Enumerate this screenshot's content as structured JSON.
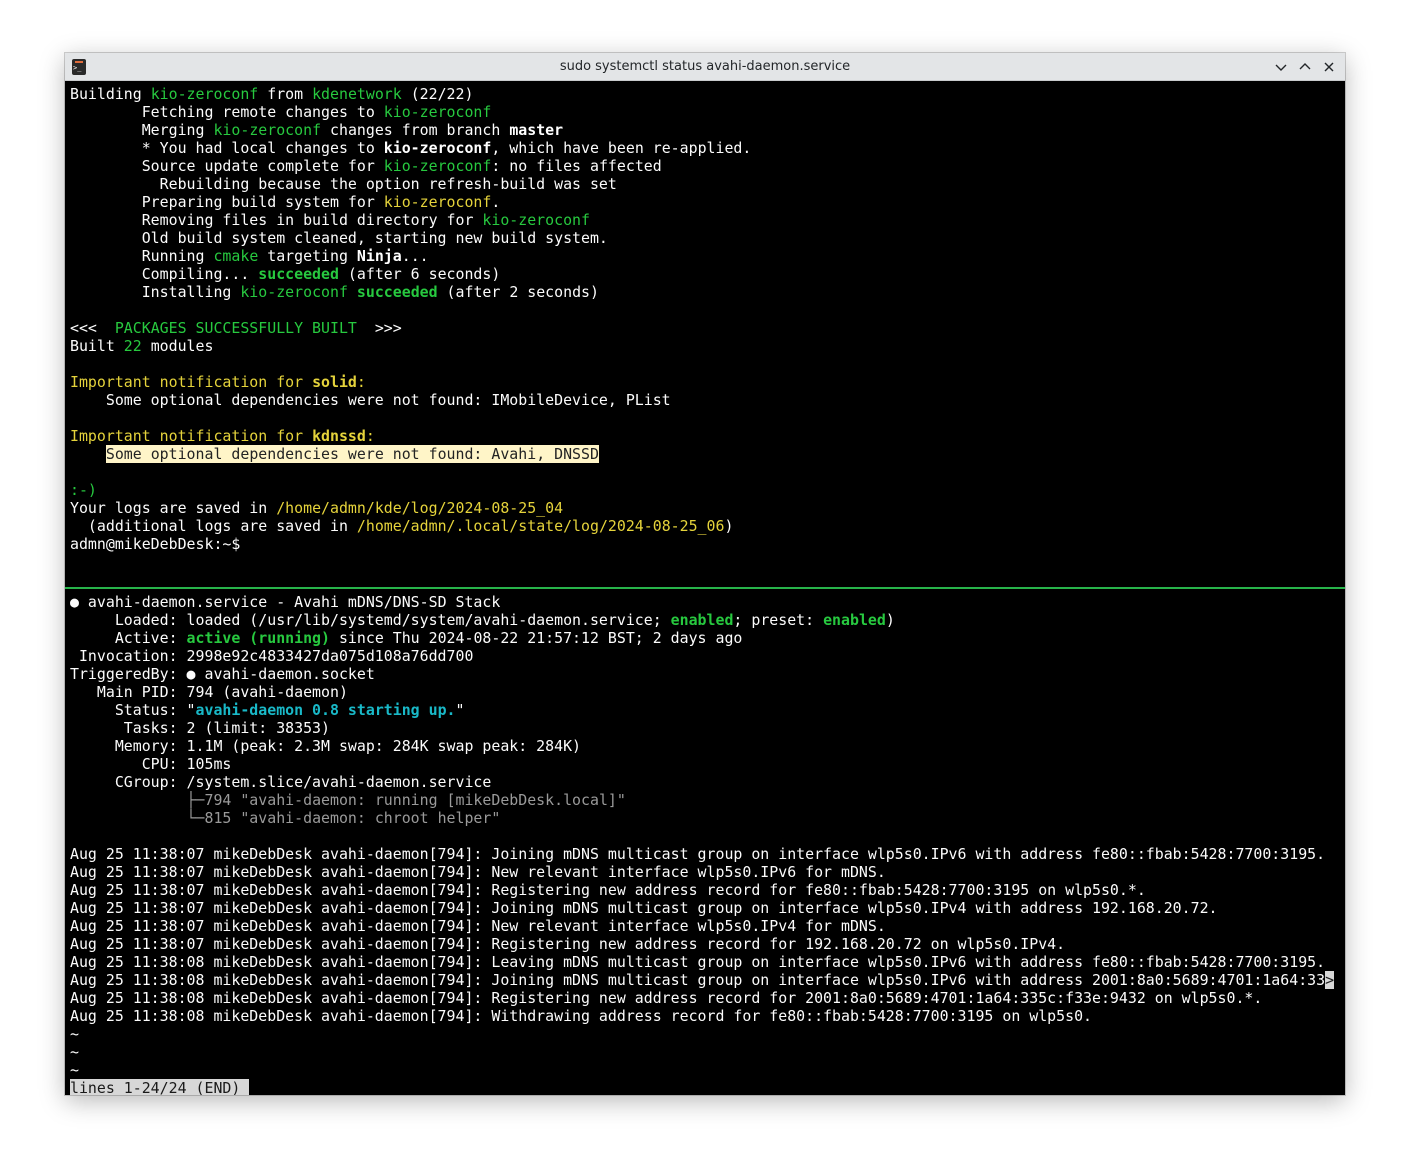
{
  "window": {
    "title": "sudo systemctl status avahi-daemon.service"
  },
  "top_pane": {
    "lines": [
      [
        {
          "t": "Building "
        },
        {
          "t": "kio-zeroconf",
          "s": "g"
        },
        {
          "t": " from "
        },
        {
          "t": "kdenetwork",
          "s": "g"
        },
        {
          "t": " (22/22)"
        }
      ],
      [
        {
          "t": "        Fetching remote changes to "
        },
        {
          "t": "kio-zeroconf",
          "s": "g"
        }
      ],
      [
        {
          "t": "        Merging "
        },
        {
          "t": "kio-zeroconf",
          "s": "g"
        },
        {
          "t": " changes from branch "
        },
        {
          "t": "master",
          "s": "b"
        }
      ],
      [
        {
          "t": "        * You had local changes to "
        },
        {
          "t": "kio-zeroconf",
          "s": "b"
        },
        {
          "t": ", which have been re-applied."
        }
      ],
      [
        {
          "t": "        Source update complete for "
        },
        {
          "t": "kio-zeroconf",
          "s": "g"
        },
        {
          "t": ": no files affected"
        }
      ],
      [
        {
          "t": "          Rebuilding because the option refresh-build was set"
        }
      ],
      [
        {
          "t": "        Preparing build system for "
        },
        {
          "t": "kio-zeroconf",
          "s": "y"
        },
        {
          "t": "."
        }
      ],
      [
        {
          "t": "        Removing files in build directory for "
        },
        {
          "t": "kio-zeroconf",
          "s": "g"
        }
      ],
      [
        {
          "t": "        Old build system cleaned, starting new build system."
        }
      ],
      [
        {
          "t": "        Running "
        },
        {
          "t": "cmake",
          "s": "g"
        },
        {
          "t": " targeting "
        },
        {
          "t": "Ninja",
          "s": "b"
        },
        {
          "t": "..."
        }
      ],
      [
        {
          "t": "        Compiling... "
        },
        {
          "t": "succeeded",
          "s": "gb"
        },
        {
          "t": " (after 6 seconds)"
        }
      ],
      [
        {
          "t": "        Installing "
        },
        {
          "t": "kio-zeroconf",
          "s": "g"
        },
        {
          "t": " "
        },
        {
          "t": "succeeded",
          "s": "gb"
        },
        {
          "t": " (after 2 seconds)"
        }
      ],
      [],
      [
        {
          "t": "<<<  "
        },
        {
          "t": "PACKAGES SUCCESSFULLY BUILT",
          "s": "g"
        },
        {
          "t": "  >>>"
        }
      ],
      [
        {
          "t": "Built "
        },
        {
          "t": "22",
          "s": "g"
        },
        {
          "t": " modules"
        }
      ],
      [],
      [
        {
          "t": "Important notification for ",
          "s": "y"
        },
        {
          "t": "solid",
          "s": "yb"
        },
        {
          "t": ":",
          "s": "y"
        }
      ],
      [
        {
          "t": "    Some optional dependencies were not found: IMobileDevice, PList"
        }
      ],
      [],
      [
        {
          "t": "Important notification for ",
          "s": "y"
        },
        {
          "t": "kdnssd",
          "s": "yb"
        },
        {
          "t": ":",
          "s": "y"
        }
      ],
      [
        {
          "t": "    "
        },
        {
          "t": "Some optional dependencies were not found: Avahi, DNSSD",
          "s": "hl"
        }
      ],
      [],
      [
        {
          "t": ":-)",
          "s": "g"
        }
      ],
      [
        {
          "t": "Your logs are saved in "
        },
        {
          "t": "/home/admn/kde/log/2024-08-25_04",
          "s": "y"
        }
      ],
      [
        {
          "t": "  (additional logs are saved in "
        },
        {
          "t": "/home/admn/.local/state/log/2024-08-25_06",
          "s": "y"
        },
        {
          "t": ")"
        }
      ],
      [
        {
          "t": "admn@mikeDebDesk:~$ "
        }
      ]
    ]
  },
  "bottom_pane": {
    "lines": [
      [
        {
          "t": "●",
          "s": "dot"
        },
        {
          "t": " avahi-daemon.service - Avahi mDNS/DNS-SD Stack"
        }
      ],
      [
        {
          "t": "     Loaded: loaded (/usr/lib/systemd/system/avahi-daemon.service; "
        },
        {
          "t": "enabled",
          "s": "gb"
        },
        {
          "t": "; preset: "
        },
        {
          "t": "enabled",
          "s": "gb"
        },
        {
          "t": ")"
        }
      ],
      [
        {
          "t": "     Active: "
        },
        {
          "t": "active (running)",
          "s": "gb"
        },
        {
          "t": " since Thu 2024-08-22 21:57:12 BST; 2 days ago"
        }
      ],
      [
        {
          "t": " Invocation: 2998e92c4833427da075d108a76dd700"
        }
      ],
      [
        {
          "t": "TriggeredBy: "
        },
        {
          "t": "●",
          "s": "dot"
        },
        {
          "t": " avahi-daemon.socket"
        }
      ],
      [
        {
          "t": "   Main PID: 794 (avahi-daemon)"
        }
      ],
      [
        {
          "t": "     Status: \""
        },
        {
          "t": "avahi-daemon 0.8 starting up.",
          "s": "c"
        },
        {
          "t": "\""
        }
      ],
      [
        {
          "t": "      Tasks: 2 (limit: 38353)"
        }
      ],
      [
        {
          "t": "     Memory: 1.1M (peak: 2.3M swap: 284K swap peak: 284K)"
        }
      ],
      [
        {
          "t": "        CPU: 105ms"
        }
      ],
      [
        {
          "t": "     CGroup: /system.slice/avahi-daemon.service"
        }
      ],
      [
        {
          "t": "             ├─",
          "s": "dim"
        },
        {
          "t": "794 \"avahi-daemon: running [mikeDebDesk.local]\"",
          "s": "dim"
        }
      ],
      [
        {
          "t": "             └─",
          "s": "dim"
        },
        {
          "t": "815 \"avahi-daemon: chroot helper\"",
          "s": "dim"
        }
      ],
      [],
      [
        {
          "t": "Aug 25 11:38:07 mikeDebDesk avahi-daemon[794]: Joining mDNS multicast group on interface wlp5s0.IPv6 with address fe80::fbab:5428:7700:3195."
        }
      ],
      [
        {
          "t": "Aug 25 11:38:07 mikeDebDesk avahi-daemon[794]: New relevant interface wlp5s0.IPv6 for mDNS."
        }
      ],
      [
        {
          "t": "Aug 25 11:38:07 mikeDebDesk avahi-daemon[794]: Registering new address record for fe80::fbab:5428:7700:3195 on wlp5s0.*."
        }
      ],
      [
        {
          "t": "Aug 25 11:38:07 mikeDebDesk avahi-daemon[794]: Joining mDNS multicast group on interface wlp5s0.IPv4 with address 192.168.20.72."
        }
      ],
      [
        {
          "t": "Aug 25 11:38:07 mikeDebDesk avahi-daemon[794]: New relevant interface wlp5s0.IPv4 for mDNS."
        }
      ],
      [
        {
          "t": "Aug 25 11:38:07 mikeDebDesk avahi-daemon[794]: Registering new address record for 192.168.20.72 on wlp5s0.IPv4."
        }
      ],
      [
        {
          "t": "Aug 25 11:38:08 mikeDebDesk avahi-daemon[794]: Leaving mDNS multicast group on interface wlp5s0.IPv6 with address fe80::fbab:5428:7700:3195."
        }
      ],
      [
        {
          "t": "Aug 25 11:38:08 mikeDebDesk avahi-daemon[794]: Joining mDNS multicast group on interface wlp5s0.IPv6 with address 2001:8a0:5689:4701:1a64:33"
        },
        {
          "t": ">",
          "s": "inv"
        }
      ],
      [
        {
          "t": "Aug 25 11:38:08 mikeDebDesk avahi-daemon[794]: Registering new address record for 2001:8a0:5689:4701:1a64:335c:f33e:9432 on wlp5s0.*."
        }
      ],
      [
        {
          "t": "Aug 25 11:38:08 mikeDebDesk avahi-daemon[794]: Withdrawing address record for fe80::fbab:5428:7700:3195 on wlp5s0."
        }
      ],
      [
        {
          "t": "~"
        }
      ],
      [
        {
          "t": "~"
        }
      ],
      [
        {
          "t": "~"
        }
      ],
      [
        {
          "t": "lines 1-24/24 (END) ",
          "s": "inv"
        }
      ]
    ]
  }
}
